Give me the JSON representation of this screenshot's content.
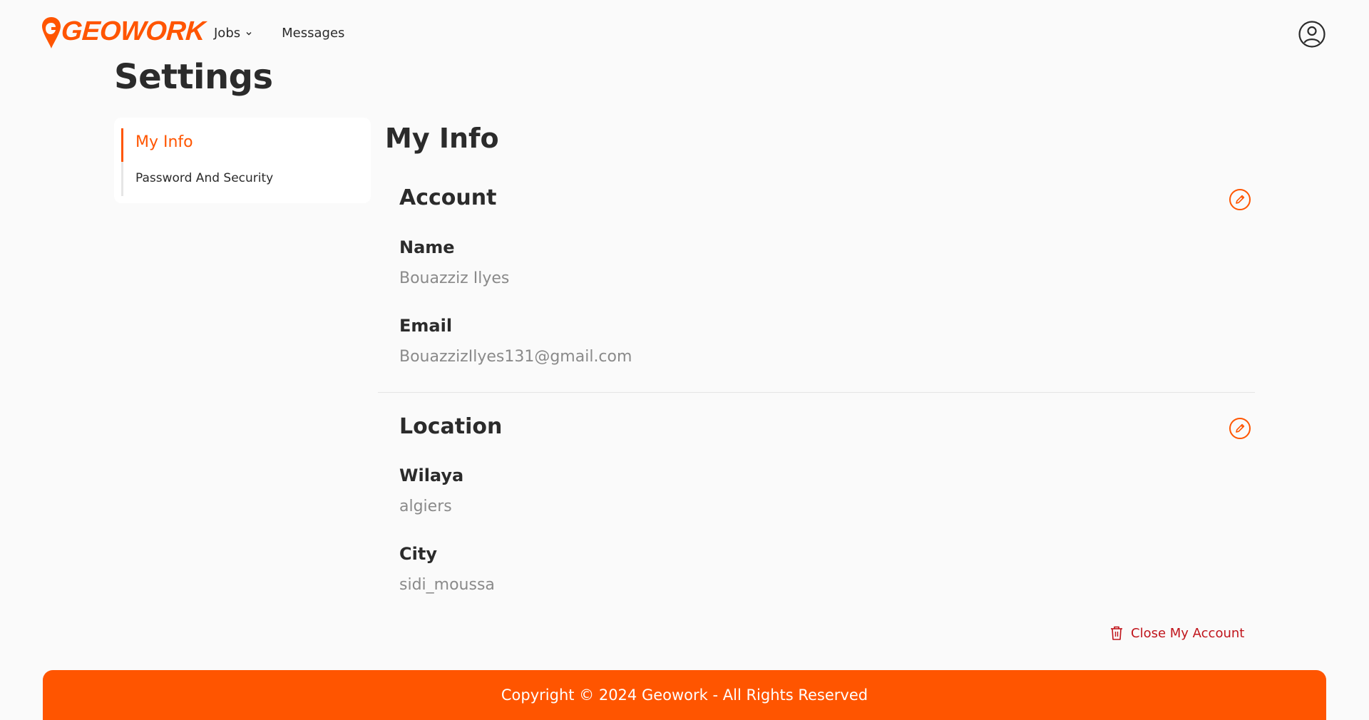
{
  "brand": {
    "logo_text": "GEOWORK",
    "accent_color": "#ff5500"
  },
  "nav": {
    "jobs_label": "Jobs",
    "messages_label": "Messages"
  },
  "page": {
    "title": "Settings"
  },
  "sidebar": {
    "items": [
      {
        "label": "My Info",
        "active": true
      },
      {
        "label": "Password And Security",
        "active": false
      }
    ]
  },
  "main": {
    "title": "My Info",
    "account": {
      "title": "Account",
      "name_label": "Name",
      "name_value": "Bouazziz Ilyes",
      "email_label": "Email",
      "email_value": "BouazzizIlyes131@gmail.com"
    },
    "location": {
      "title": "Location",
      "wilaya_label": "Wilaya",
      "wilaya_value": "algiers",
      "city_label": "City",
      "city_value": "sidi_moussa"
    },
    "close_account_label": "Close My Account"
  },
  "footer": {
    "text": "Copyright © 2024 Geowork - All Rights Reserved"
  },
  "icons": {
    "user": "user-circle-icon",
    "edit": "pencil-circle-icon",
    "trash": "trash-icon",
    "chevron": "chevron-down-icon"
  }
}
